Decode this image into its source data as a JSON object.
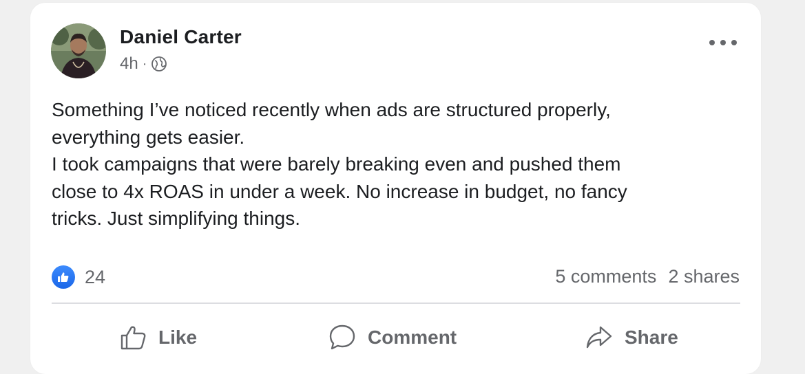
{
  "post": {
    "author": "Daniel Carter",
    "time": "4h",
    "separator": "·",
    "privacy_icon": "globe-icon",
    "more_icon": "more-options-icon",
    "lines": [
      "Something I’ve noticed recently when ads are structured properly,",
      "everything gets easier.",
      "I took campaigns that were barely breaking even and pushed them",
      "close to 4x ROAS in under a week. No increase in budget, no fancy",
      "tricks. Just simplifying things."
    ]
  },
  "stats": {
    "reaction_count": "24",
    "comments": "5 comments",
    "shares": "2 shares"
  },
  "actions": {
    "like": "Like",
    "comment": "Comment",
    "share": "Share"
  },
  "colors": {
    "accent": "#1877f2",
    "secondary_text": "#65676b",
    "primary_text": "#1c1e21"
  }
}
